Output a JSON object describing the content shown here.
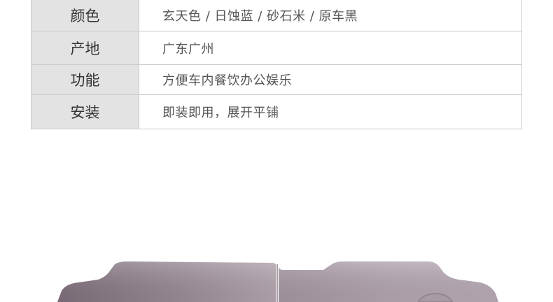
{
  "specs": {
    "rows": [
      {
        "label": "颜色",
        "value": "玄天色 / 日蚀蓝 / 砂石米 / 原车黑"
      },
      {
        "label": "产地",
        "value": "广东广州"
      },
      {
        "label": "功能",
        "value": "方便车内餐饮办公娱乐"
      },
      {
        "label": "安装",
        "value": "即装即用，展开平铺"
      }
    ]
  },
  "colors": {
    "label_bg": "#e3e3e3",
    "border": "#c9c9c9",
    "product_light": "#b8a9b4",
    "product_dark": "#7e6f7b"
  }
}
